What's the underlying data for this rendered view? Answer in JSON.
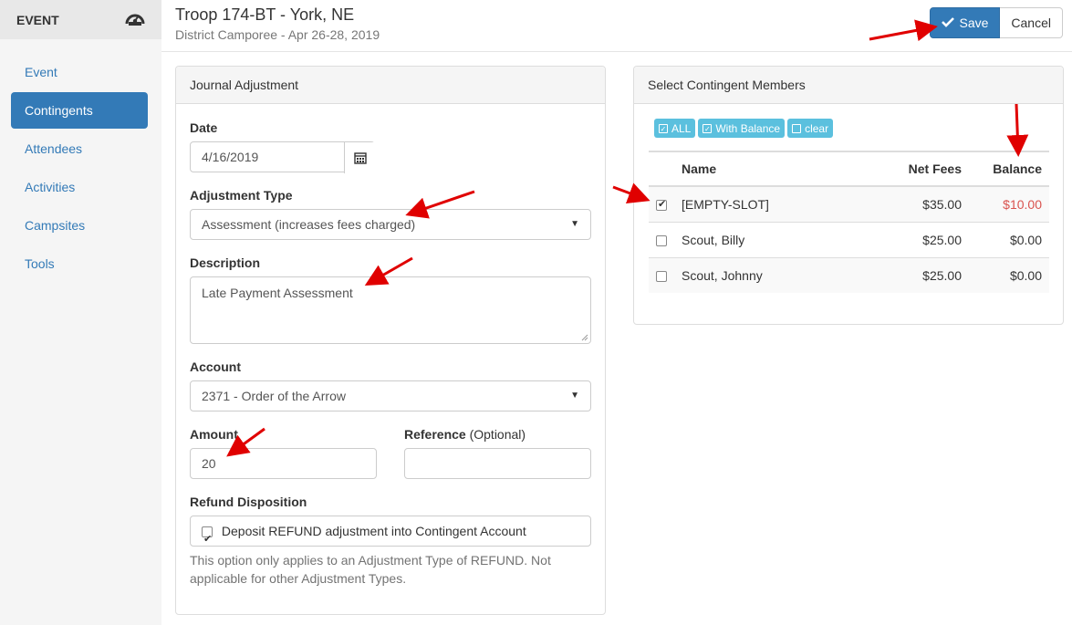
{
  "sidebar": {
    "header": "EVENT",
    "header_icon": "dashboard-gauge-icon",
    "items": [
      {
        "label": "Event",
        "active": false
      },
      {
        "label": "Contingents",
        "active": true
      },
      {
        "label": "Attendees",
        "active": false
      },
      {
        "label": "Activities",
        "active": false
      },
      {
        "label": "Campsites",
        "active": false
      },
      {
        "label": "Tools",
        "active": false
      }
    ]
  },
  "header": {
    "title": "Troop 174-BT - York, NE",
    "subtitle": "District Camporee - Apr 26-28, 2019",
    "save_label": "Save",
    "cancel_label": "Cancel"
  },
  "journal": {
    "heading": "Journal Adjustment",
    "date_label": "Date",
    "date_value": "4/16/2019",
    "adjustment_type_label": "Adjustment Type",
    "adjustment_type_value": "Assessment (increases fees charged)",
    "description_label": "Description",
    "description_value": "Late Payment Assessment",
    "account_label": "Account",
    "account_value": "2371 - Order of the Arrow",
    "amount_label": "Amount",
    "amount_value": "20",
    "reference_label": "Reference",
    "reference_optional": "(Optional)",
    "reference_value": "",
    "refund_label": "Refund Disposition",
    "refund_checkbox_label": "Deposit REFUND adjustment into Contingent Account",
    "refund_checked": true,
    "help_text": "This option only applies to an Adjustment Type of REFUND. Not applicable for other Adjustment Types."
  },
  "members": {
    "heading": "Select Contingent Members",
    "chips": [
      "ALL",
      "With Balance",
      "clear"
    ],
    "columns": [
      "Name",
      "Net Fees",
      "Balance"
    ],
    "rows": [
      {
        "name": "[EMPTY-SLOT]",
        "net_fees": "$35.00",
        "balance": "$10.00",
        "checked": true,
        "balance_color": "#d9534f"
      },
      {
        "name": "Scout, Billy",
        "net_fees": "$25.00",
        "balance": "$0.00",
        "checked": false
      },
      {
        "name": "Scout, Johnny",
        "net_fees": "$25.00",
        "balance": "$0.00",
        "checked": false
      }
    ]
  },
  "colors": {
    "primary": "#337ab7",
    "info": "#5bc0de",
    "danger": "#d9534f",
    "annotation_arrow": "#e00000"
  }
}
